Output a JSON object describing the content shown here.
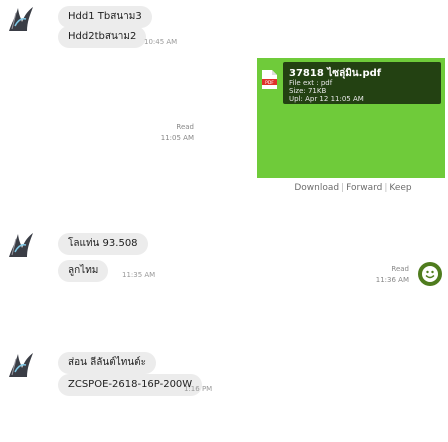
{
  "messages": [
    {
      "sender_text": "Hdd1 Tbสนาม3",
      "text": "Hdd2tbสนาม2",
      "time": "10:45 AM"
    },
    {
      "file": {
        "name": "37818 ไซลุ่มิน.pdf",
        "type_label": "File ext : pdf",
        "size_label": "Size: 71KB",
        "date_label": "Upl: Apr 12 11:05 AM"
      },
      "read_label": "Read",
      "time": "11:05 AM",
      "actions": [
        "Download",
        "Forward",
        "Keep"
      ]
    },
    {
      "sender_text": "โลแท่น 93.508",
      "text": "ลูกไทม",
      "time": "11:35 AM"
    },
    {
      "read_label": "Read",
      "time": "11:36 AM",
      "sticker": "smiley-sticker-icon"
    },
    {
      "sender_text": "ส่อน ลีลันต์ไทนต์ะ",
      "text": "ZCSPOE-2618-16P-200W",
      "time": "1:16 PM"
    }
  ],
  "avatar_icon": "user-avatar-icon",
  "colors": {
    "bubble": "#ececec",
    "file_preview": "#6fcb3a",
    "sticker": "#4f7c1e"
  }
}
